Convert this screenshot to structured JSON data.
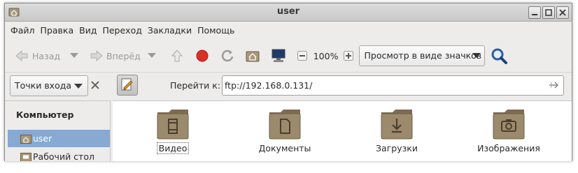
{
  "window": {
    "title": "user"
  },
  "menu": [
    "Файл",
    "Правка",
    "Вид",
    "Переход",
    "Закладки",
    "Помощь"
  ],
  "toolbar": {
    "back_label": "Назад",
    "forward_label": "Вперёд",
    "zoom": "100%",
    "view_mode": "Просмотр в виде значков"
  },
  "location": {
    "places_label": "Точки входа",
    "goto_label": "Перейти к:",
    "url": "ftp://192.168.0.131/"
  },
  "sidebar": {
    "heading": "Компьютер",
    "items": [
      {
        "label": "user",
        "icon": "home-folder-icon",
        "selected": true
      },
      {
        "label": "Рабочий стол",
        "icon": "desktop-folder-icon",
        "selected": false
      }
    ]
  },
  "files": [
    {
      "name": "Видео",
      "icon": "video-folder-icon"
    },
    {
      "name": "Документы",
      "icon": "documents-folder-icon"
    },
    {
      "name": "Загрузки",
      "icon": "downloads-folder-icon"
    },
    {
      "name": "Изображения",
      "icon": "pictures-folder-icon"
    }
  ],
  "colors": {
    "selection": "#88a9d1",
    "folder": "#9c8a6d",
    "stop": "#d93025",
    "search": "#2b5aa8"
  }
}
